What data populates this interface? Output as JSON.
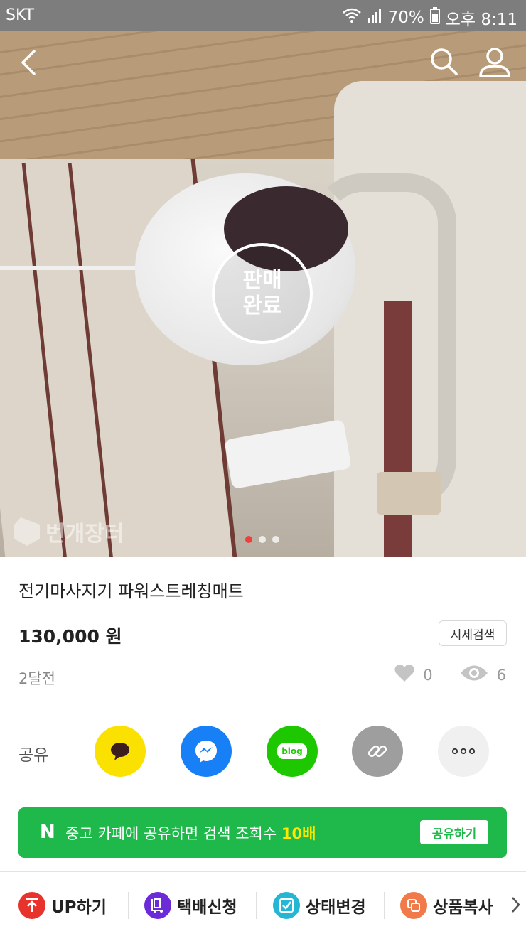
{
  "status_bar": {
    "carrier": "SKT",
    "battery": "70%",
    "time": "오후 8:11"
  },
  "hero": {
    "sold_badge_line1": "판매",
    "sold_badge_line2": "완료",
    "watermark": "번개장터",
    "carousel_total": 3,
    "carousel_active": 1
  },
  "product": {
    "title": "전기마사지기 파워스트레칭매트",
    "price": "130,000 원",
    "price_search_label": "시세검색",
    "posted": "2달전",
    "likes": "0",
    "views": "6"
  },
  "share": {
    "label": "공유",
    "blog_text": "blog",
    "colors": {
      "kakao": "#fae100",
      "messenger": "#1780f6",
      "blog": "#1ec800",
      "link": "#9e9e9e"
    }
  },
  "naver_banner": {
    "logo": "N",
    "message": "중고 카페에 공유하면 검색 조회수 ",
    "highlight": "10배",
    "button": "공유하기"
  },
  "bottom_bar": {
    "items": [
      {
        "label": "UP하기",
        "icon": "arrow-up-icon",
        "color": "#e8322c"
      },
      {
        "label": "택배신청",
        "icon": "delivery-icon",
        "color": "#6b2bd8"
      },
      {
        "label": "상태변경",
        "icon": "checkbox-icon",
        "color": "#23b7d5"
      },
      {
        "label": "상품복사",
        "icon": "copy-icon",
        "color": "#f07a4a"
      }
    ]
  }
}
